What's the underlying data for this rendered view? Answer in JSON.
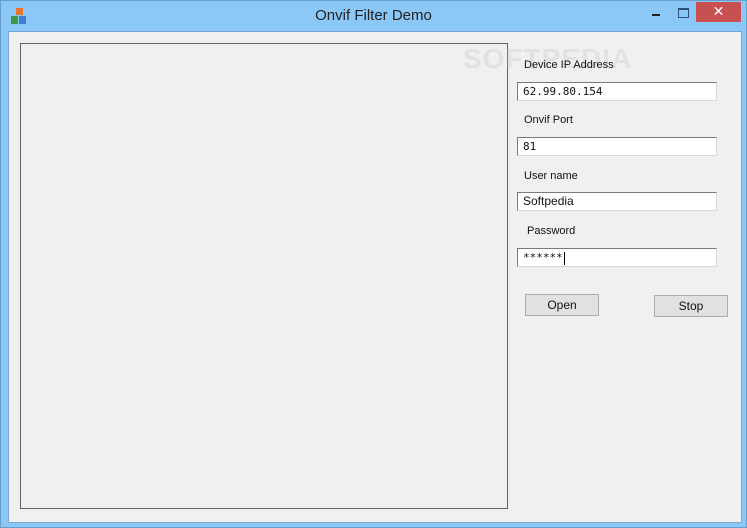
{
  "window": {
    "title": "Onvif Filter Demo",
    "close_glyph": "✕"
  },
  "form": {
    "device_ip_label": "Device IP Address",
    "device_ip_value": "62.99.80.154",
    "port_label": "Onvif Port",
    "port_value": "81",
    "username_label": "User name",
    "username_value": "Softpedia",
    "password_label": "Password",
    "password_value": "******"
  },
  "buttons": {
    "open_label": "Open",
    "stop_label": "Stop"
  },
  "watermark": "SOFTPEDIA"
}
